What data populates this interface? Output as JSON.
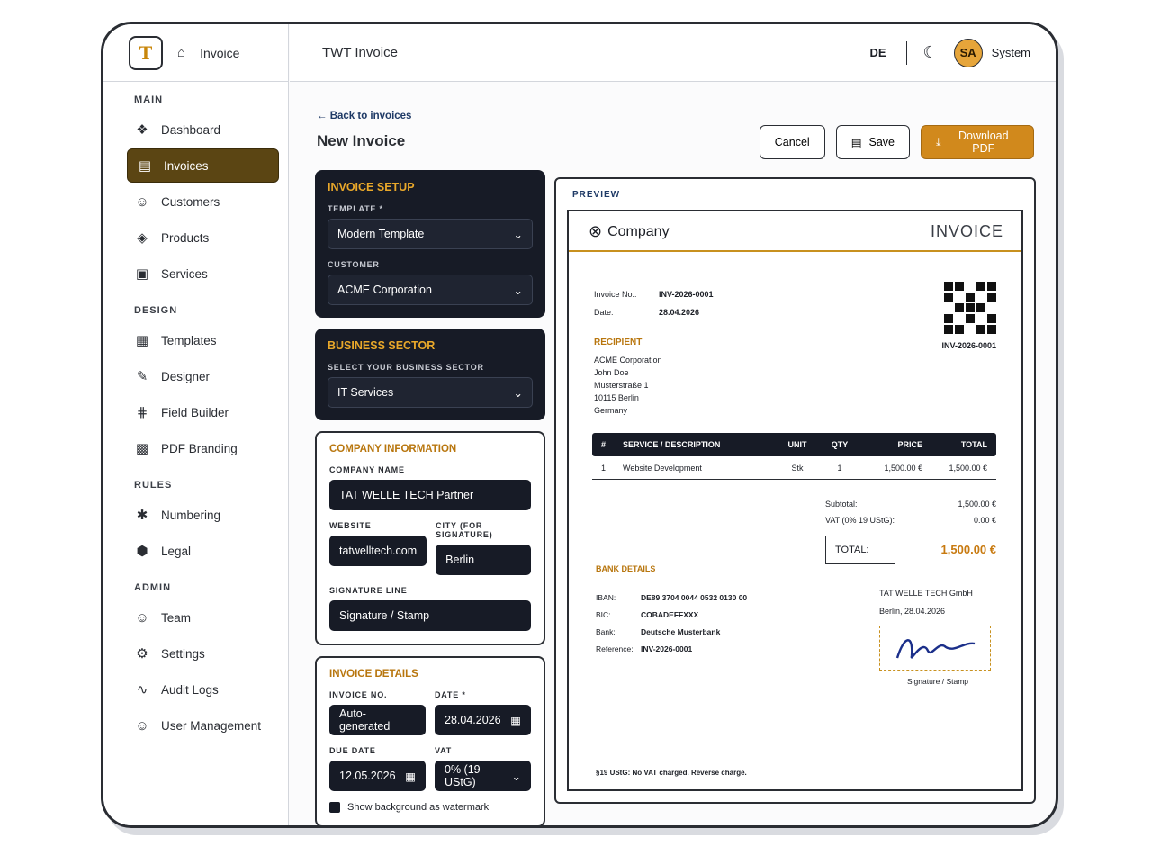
{
  "brand": {
    "logo_letter": "T",
    "label": "Invoice"
  },
  "nav": [
    {
      "type": "section",
      "label": "MAIN"
    },
    {
      "type": "item",
      "label": "Dashboard",
      "icon": "❖",
      "name": "sidebar-item-dashboard"
    },
    {
      "type": "item",
      "label": "Invoices",
      "icon": "▤",
      "name": "sidebar-item-invoices",
      "active": true
    },
    {
      "type": "item",
      "label": "Customers",
      "icon": "☺",
      "name": "sidebar-item-customers"
    },
    {
      "type": "item",
      "label": "Products",
      "icon": "◈",
      "name": "sidebar-item-products"
    },
    {
      "type": "item",
      "label": "Services",
      "icon": "▣",
      "name": "sidebar-item-services"
    },
    {
      "type": "section",
      "label": "DESIGN"
    },
    {
      "type": "item",
      "label": "Templates",
      "icon": "▦",
      "name": "sidebar-item-templates"
    },
    {
      "type": "item",
      "label": "Designer",
      "icon": "✎",
      "name": "sidebar-item-designer"
    },
    {
      "type": "item",
      "label": "Field Builder",
      "icon": "⋕",
      "name": "sidebar-item-field-builder"
    },
    {
      "type": "item",
      "label": "PDF Branding",
      "icon": "▩",
      "name": "sidebar-item-pdf-branding"
    },
    {
      "type": "section",
      "label": "RULES"
    },
    {
      "type": "item",
      "label": "Numbering",
      "icon": "✱",
      "name": "sidebar-item-numbering"
    },
    {
      "type": "item",
      "label": "Legal",
      "icon": "⬢",
      "name": "sidebar-item-legal"
    },
    {
      "type": "section",
      "label": "ADMIN"
    },
    {
      "type": "item",
      "label": "Team",
      "icon": "☺",
      "name": "sidebar-item-team"
    },
    {
      "type": "item",
      "label": "Settings",
      "icon": "⚙",
      "name": "sidebar-item-settings"
    },
    {
      "type": "item",
      "label": "Audit Logs",
      "icon": "∿",
      "name": "sidebar-item-audit-logs"
    },
    {
      "type": "item",
      "label": "User Management",
      "icon": "☺",
      "name": "sidebar-item-user-management"
    }
  ],
  "topbar": {
    "title": "TWT Invoice",
    "lang": "DE",
    "avatar": "SA",
    "user": "System"
  },
  "page": {
    "back": "← Back to invoices",
    "title": "New Invoice",
    "cancel": "Cancel",
    "save": "Save",
    "download": "Download PDF"
  },
  "setup": {
    "title": "INVOICE SETUP",
    "template_label": "TEMPLATE *",
    "template_value": "Modern Template",
    "customer_label": "CUSTOMER",
    "customer_value": "ACME Corporation"
  },
  "sector": {
    "title": "BUSINESS SECTOR",
    "label": "SELECT YOUR BUSINESS SECTOR",
    "value": "IT Services"
  },
  "company_info": {
    "title": "COMPANY INFORMATION",
    "name_label": "COMPANY NAME",
    "name_value": "TAT WELLE TECH Partner",
    "website_label": "WEBSITE",
    "website_value": "tatwelltech.com",
    "city_label": "CITY (FOR SIGNATURE)",
    "city_value": "Berlin",
    "sig_label": "SIGNATURE LINE",
    "sig_value": "Signature / Stamp"
  },
  "details": {
    "title": "INVOICE DETAILS",
    "no_label": "INVOICE NO.",
    "no_placeholder": "Auto-generated",
    "date_label": "DATE *",
    "date_value": "28.04.2026",
    "due_label": "DUE DATE",
    "due_value": "12.05.2026",
    "vat_label": "VAT",
    "vat_value": "0% (19 UStG)",
    "watermark_label": "Show background as watermark"
  },
  "preview": {
    "label": "PREVIEW",
    "company": "Company",
    "heading": "INVOICE",
    "invoice_no_label": "Invoice No.:",
    "invoice_no": "INV-2026-0001",
    "date_label": "Date:",
    "date": "28.04.2026",
    "qr_caption": "INV-2026-0001",
    "recipient_title": "RECIPIENT",
    "recipient_lines": [
      "ACME Corporation",
      "John Doe",
      "Musterstraße 1",
      "10115 Berlin",
      "Germany"
    ],
    "columns": {
      "pos": "#",
      "desc": "SERVICE / DESCRIPTION",
      "unit": "UNIT",
      "qty": "QTY",
      "price": "PRICE",
      "total": "TOTAL"
    },
    "rows": [
      {
        "pos": "1",
        "desc": "Website Development",
        "unit": "Stk",
        "qty": "1",
        "price": "1,500.00 €",
        "total": "1,500.00 €"
      }
    ],
    "subtotal_label": "Subtotal:",
    "subtotal": "1,500.00 €",
    "vat_label": "VAT (0% 19 UStG):",
    "vat": "0.00 €",
    "total_label": "TOTAL:",
    "total": "1,500.00 €",
    "bank_title": "BANK DETAILS",
    "bank": [
      {
        "k": "IBAN:",
        "v": "DE89 3704 0044 0532 0130 00"
      },
      {
        "k": "BIC:",
        "v": "COBADEFFXXX"
      },
      {
        "k": "Bank:",
        "v": "Deutsche Musterbank"
      },
      {
        "k": "Reference:",
        "v": "INV-2026-0001"
      }
    ],
    "signer_company": "TAT WELLE TECH GmbH",
    "signer_place_date": "Berlin, 28.04.2026",
    "signature_caption": "Signature / Stamp",
    "footnote": "§19 UStG: No VAT charged. Reverse charge."
  },
  "colors": {
    "accent": "#d1891c",
    "dark_card": "#171b26",
    "active_nav": "#5b4513"
  }
}
